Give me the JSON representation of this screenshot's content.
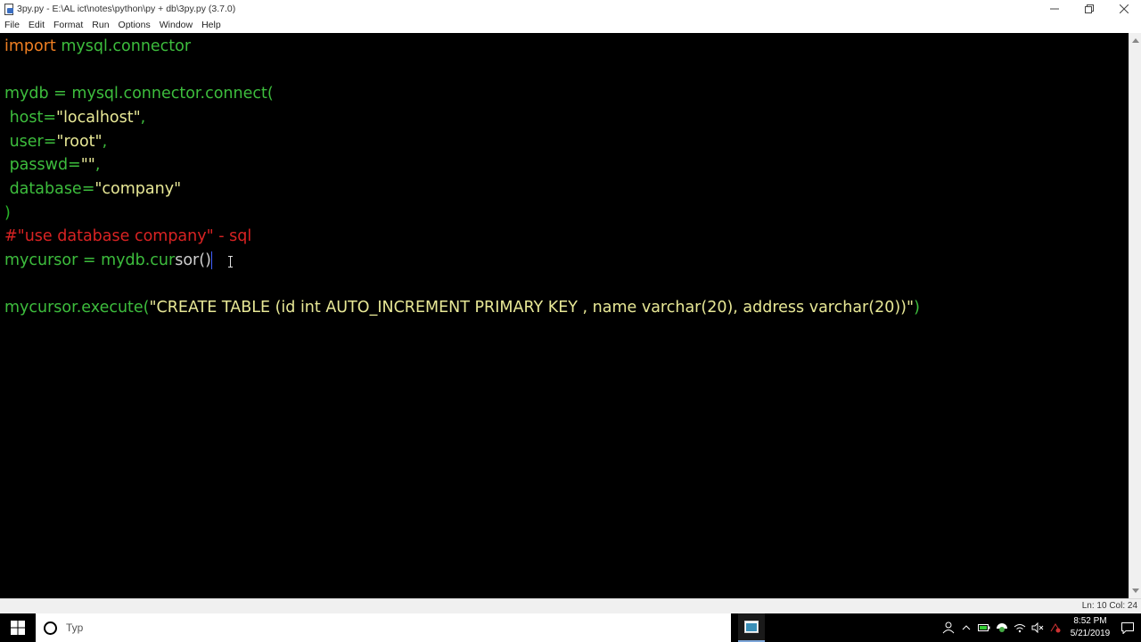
{
  "window": {
    "title": "3py.py - E:\\AL ict\\notes\\python\\py + db\\3py.py (3.7.0)",
    "icon": "idle-file-icon"
  },
  "menu": {
    "items": [
      "File",
      "Edit",
      "Format",
      "Run",
      "Options",
      "Window",
      "Help"
    ]
  },
  "editor": {
    "line1_kw": "import",
    "line1_rest": " mysql.connector",
    "line3": "mydb = mysql.connector.connect(",
    "line4_a": " host=",
    "line4_b": "\"localhost\"",
    "line4_c": ",",
    "line5_a": " user=",
    "line5_b": "\"root\"",
    "line5_c": ",",
    "line6_a": " passwd=",
    "line6_b": "\"\"",
    "line6_c": ",",
    "line7_a": " database=",
    "line7_b": "\"company\"",
    "line8": ")",
    "line9": "#\"use database company\" - sql",
    "line10_a": "mycursor = mydb.cur",
    "line10_b": "sor()",
    "line12_a": "mycursor.execute(",
    "line12_b": "\"CREATE TABLE (id int AUTO_INCREMENT PRIMARY KEY , name varchar(20), address varchar(20))\"",
    "line12_c": ")"
  },
  "status": {
    "position": "Ln: 10   Col: 24"
  },
  "taskbar": {
    "search_placeholder": "Typ",
    "time": "8:52 PM",
    "date": "5/21/2019"
  },
  "colors": {
    "keyword": "#f07f22",
    "builtin": "#3dbd3d",
    "string": "#e8e896",
    "comment": "#d92323",
    "background": "#000000"
  }
}
